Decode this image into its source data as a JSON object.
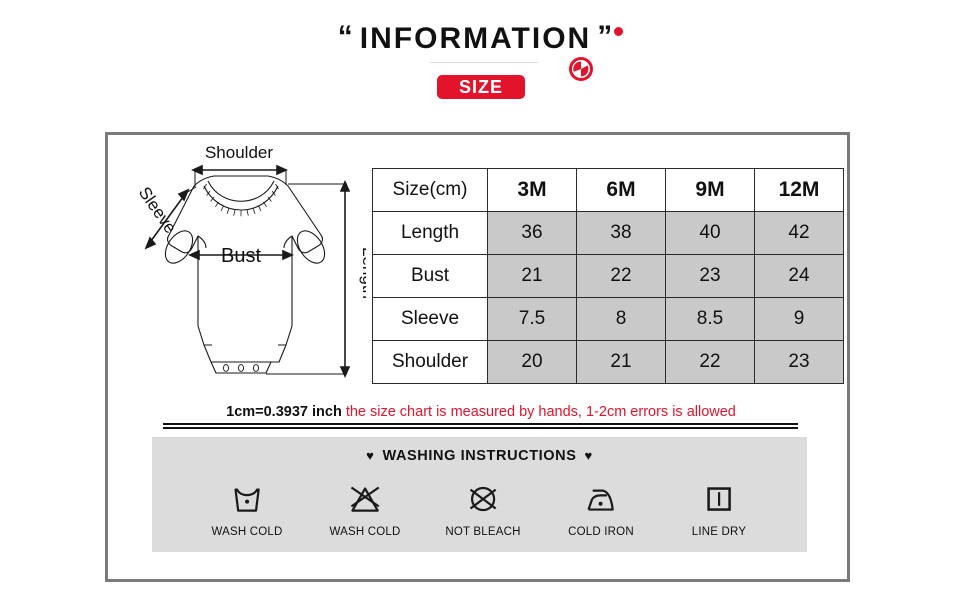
{
  "header": {
    "quote_open": "“",
    "quote_close": "”",
    "title": "INFORMATION",
    "badge_label": "SIZE",
    "accent_color": "#e3132c",
    "circle_icon": "clock-circle-icon",
    "dot_icon": "red-dot-icon"
  },
  "diagram": {
    "name": "baby-bodysuit-diagram",
    "labels": {
      "shoulder": "Shoulder",
      "sleeve": "Sleeve",
      "bust": "Bust",
      "length": "Length"
    }
  },
  "table": {
    "header": [
      "Size(cm)",
      "3M",
      "6M",
      "9M",
      "12M"
    ],
    "rows": [
      {
        "label": "Length",
        "values": [
          "36",
          "38",
          "40",
          "42"
        ]
      },
      {
        "label": "Bust",
        "values": [
          "21",
          "22",
          "23",
          "24"
        ]
      },
      {
        "label": "Sleeve",
        "values": [
          "7.5",
          "8",
          "8.5",
          "9"
        ]
      },
      {
        "label": "Shoulder",
        "values": [
          "20",
          "21",
          "22",
          "23"
        ]
      }
    ],
    "value_cell_color": "#c9c9c9",
    "border_color": "#2b2b2b"
  },
  "note": {
    "conversion": "1cm=0.3937 inch",
    "disclaimer": "the size chart is measured by hands, 1-2cm errors is allowed",
    "disclaimer_color": "#e3132c"
  },
  "washing": {
    "title": "WASHING INSTRUCTIONS",
    "heart": "♥",
    "band_color": "#dcdcdc",
    "items": [
      {
        "icon": "wash-tub-one-dot-icon",
        "label": "WASH COLD"
      },
      {
        "icon": "no-bleach-triangle-icon",
        "label": "WASH COLD"
      },
      {
        "icon": "no-dryclean-circle-icon",
        "label": "NOT BLEACH"
      },
      {
        "icon": "iron-one-dot-icon",
        "label": "COLD IRON"
      },
      {
        "icon": "line-dry-square-icon",
        "label": "LINE DRY"
      }
    ]
  }
}
